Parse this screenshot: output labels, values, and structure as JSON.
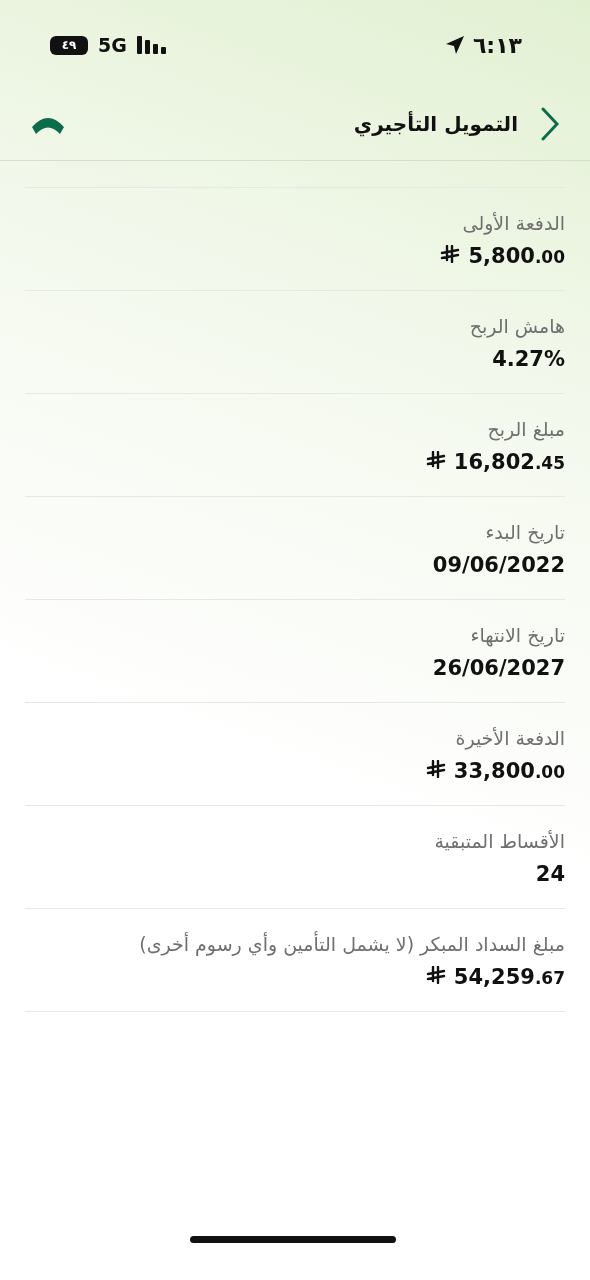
{
  "status_bar": {
    "time": "٦:١٣",
    "battery": "٤٩",
    "network": "5G"
  },
  "header": {
    "title": "التمويل التأجيري"
  },
  "details": [
    {
      "label": "الدفعة الأولى",
      "value": "5,800.00",
      "kind": "money"
    },
    {
      "label": "هامش الربح",
      "value": "4.27%",
      "kind": "plain"
    },
    {
      "label": "مبلغ الربح",
      "value": "16,802.45",
      "kind": "money"
    },
    {
      "label": "تاريخ البدء",
      "value": "09/06/2022",
      "kind": "plain"
    },
    {
      "label": "تاريخ الانتهاء",
      "value": "26/06/2027",
      "kind": "plain"
    },
    {
      "label": "الدفعة الأخيرة",
      "value": "33,800.00",
      "kind": "money"
    },
    {
      "label": "الأقساط المتبقية",
      "value": "24",
      "kind": "plain"
    },
    {
      "label": "مبلغ السداد المبكر (لا يشمل التأمين وأي رسوم أخرى)",
      "value": "54,259.67",
      "kind": "money"
    }
  ]
}
